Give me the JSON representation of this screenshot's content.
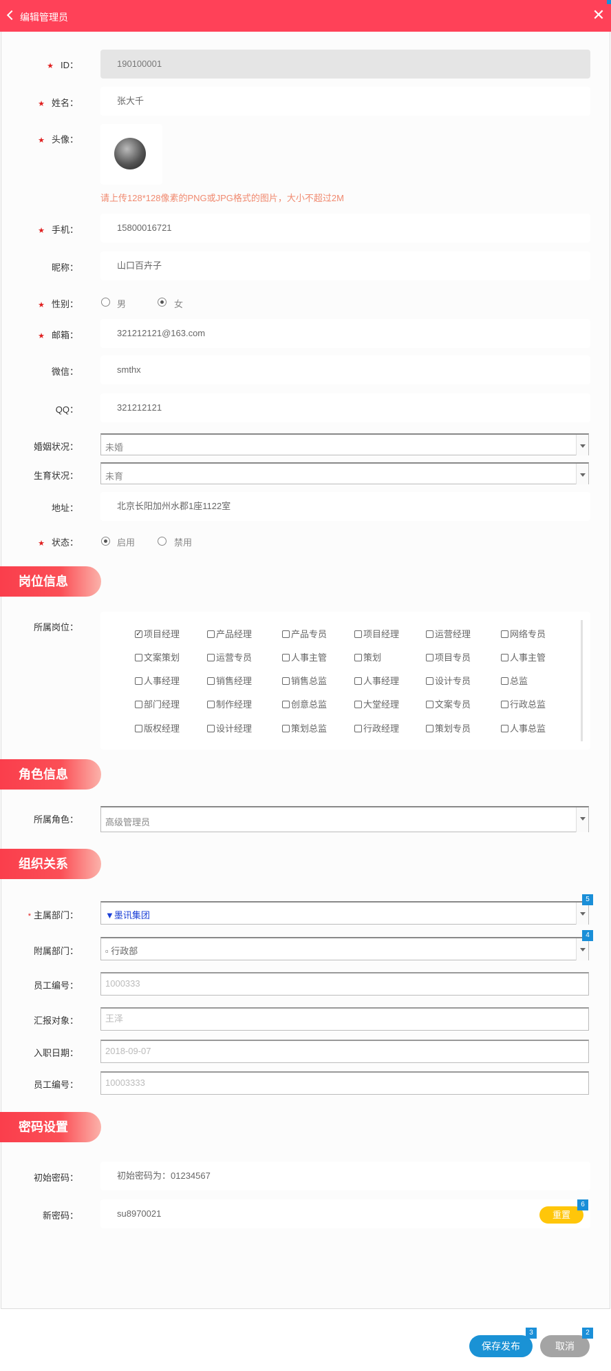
{
  "header": {
    "title": "编辑管理员"
  },
  "basic": {
    "id_label": "ID：",
    "id_value": "190100001",
    "name_label": "姓名：",
    "name_value": "张大千",
    "avatar_label": "头像：",
    "avatar_hint": "请上传128*128像素的PNG或JPG格式的图片，大小不超过2M",
    "phone_label": "手机：",
    "phone_value": "15800016721",
    "nick_label": "昵称：",
    "nick_value": "山口百卉子",
    "gender_label": "性别：",
    "gender_male": "男",
    "gender_female": "女",
    "gender_selected": "女",
    "email_label": "邮箱：",
    "email_value": "321212121@163.com",
    "wechat_label": "微信：",
    "wechat_value": "smthx",
    "qq_label": "QQ：",
    "qq_value": "321212121",
    "marriage_label": "婚姻状况：",
    "marriage_value": "未婚",
    "birth_label": "生育状况：",
    "birth_value": "未育",
    "address_label": "地址：",
    "address_value": "北京长阳加州水郡1座1122室",
    "status_label": "状态：",
    "status_on": "启用",
    "status_off": "禁用",
    "status_selected": "启用"
  },
  "position": {
    "section_title": "岗位信息",
    "label": "所属岗位：",
    "rows": [
      [
        "项目经理",
        "产品经理",
        "产品专员",
        "项目经理",
        "运营经理",
        "网络专员"
      ],
      [
        "文案策划",
        "运营专员",
        "人事主管",
        "策划",
        "项目专员",
        "人事主管"
      ],
      [
        "人事经理",
        "销售经理",
        "销售总监",
        "人事经理",
        "设计专员",
        "总监"
      ],
      [
        "部门经理",
        "制作经理",
        "创意总监",
        "大堂经理",
        "文案专员",
        "行政总监"
      ],
      [
        "版权经理",
        "设计经理",
        "策划总监",
        "行政经理",
        "策划专员",
        "人事总监"
      ]
    ],
    "checked": "项目经理"
  },
  "role": {
    "section_title": "角色信息",
    "label": "所属角色：",
    "value": "高级管理员"
  },
  "org": {
    "section_title": "组织关系",
    "dept_label": "主属部门：",
    "dept_value": "▼墨讯集团",
    "dept_badge": "5",
    "sub_dept_label": "附属部门：",
    "sub_dept_value": "▫ 行政部",
    "sub_dept_badge": "4",
    "emp_no_label": "员工编号：",
    "emp_no_value": "1000333",
    "report_label": "汇报对象：",
    "report_value": "王泽",
    "join_label": "入职日期：",
    "join_value": "2018-09-07",
    "emp_no2_label": "员工编号：",
    "emp_no2_value": "10003333"
  },
  "password": {
    "section_title": "密码设置",
    "init_label": "初始密码：",
    "init_value": "初始密码为：01234567",
    "new_label": "新密码：",
    "new_value": "su8970021",
    "reset_label": "重置",
    "reset_badge": "6"
  },
  "footer": {
    "save_label": "保存发布",
    "save_badge": "3",
    "cancel_label": "取消",
    "cancel_badge": "2"
  },
  "colors": {
    "accent": "#ff4158",
    "primary": "#1a92d5",
    "warning": "#ffc60a"
  }
}
